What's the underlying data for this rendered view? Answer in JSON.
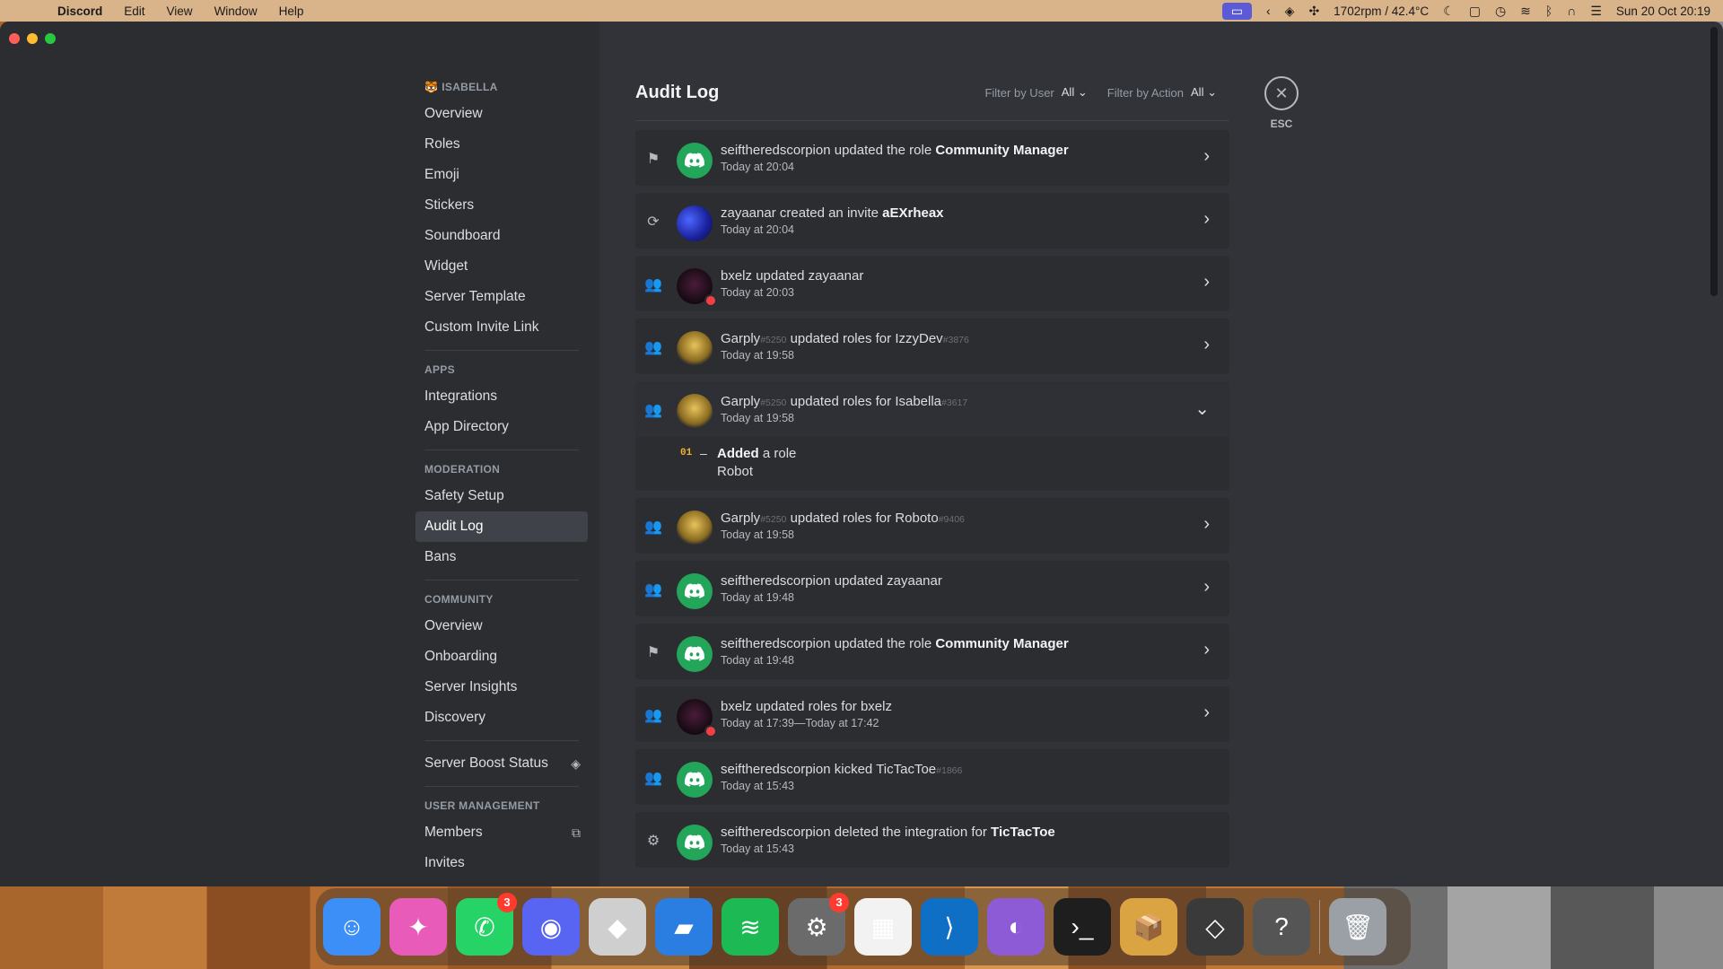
{
  "menubar": {
    "app_name": "Discord",
    "menus": [
      "Edit",
      "View",
      "Window",
      "Help"
    ],
    "fan_status": "1702rpm / 42.4°C",
    "datetime": "Sun 20 Oct  20:19"
  },
  "sidebar": {
    "server_name": "ISABELLA",
    "server_emoji": "🐯",
    "group1": [
      "Overview",
      "Roles",
      "Emoji",
      "Stickers",
      "Soundboard",
      "Widget",
      "Server Template",
      "Custom Invite Link"
    ],
    "apps_header": "APPS",
    "apps": [
      "Integrations",
      "App Directory"
    ],
    "moderation_header": "MODERATION",
    "moderation": [
      "Safety Setup",
      "Audit Log",
      "Bans"
    ],
    "community_header": "COMMUNITY",
    "community": [
      "Overview",
      "Onboarding",
      "Server Insights",
      "Discovery"
    ],
    "boost": "Server Boost Status",
    "user_mgmt_header": "USER MANAGEMENT",
    "user_mgmt": [
      "Members",
      "Invites"
    ]
  },
  "content": {
    "title": "Audit Log",
    "filter_user_label": "Filter by User",
    "filter_user_value": "All",
    "filter_action_label": "Filter by Action",
    "filter_action_value": "All"
  },
  "esc": {
    "label": "ESC",
    "icon": "close-icon"
  },
  "entries": [
    {
      "icon": "flag-icon",
      "avatar": "discord",
      "actor": "seiftheredscorpion",
      "actor_tag": "",
      "action": "updated the role",
      "target": "Community Manager",
      "target_tag": "",
      "target_bold": true,
      "time": "Today at 20:04"
    },
    {
      "icon": "invite-icon",
      "avatar": "blue",
      "actor": "zayaanar",
      "actor_tag": "",
      "action": "created an invite",
      "target": "aEXrheax",
      "target_tag": "",
      "target_bold": true,
      "time": "Today at 20:04"
    },
    {
      "icon": "member-icon",
      "avatar": "dark",
      "actor": "bxelz",
      "actor_tag": "",
      "action": "updated",
      "target": "zayaanar",
      "target_tag": "",
      "target_bold": false,
      "time": "Today at 20:03"
    },
    {
      "icon": "member-icon",
      "avatar": "robot",
      "actor": "Garply",
      "actor_tag": "#5250",
      "action": "updated roles for",
      "target": "IzzyDev",
      "target_tag": "#3876",
      "target_bold": false,
      "time": "Today at 19:58"
    },
    {
      "icon": "member-icon",
      "avatar": "robot",
      "actor": "Garply",
      "actor_tag": "#5250",
      "action": "updated roles for",
      "target": "Isabella",
      "target_tag": "#3617",
      "target_bold": false,
      "time": "Today at 19:58"
    },
    {
      "icon": "member-icon",
      "avatar": "robot",
      "actor": "Garply",
      "actor_tag": "#5250",
      "action": "updated roles for",
      "target": "Roboto",
      "target_tag": "#9406",
      "target_bold": false,
      "time": "Today at 19:58"
    },
    {
      "icon": "member-icon",
      "avatar": "discord",
      "actor": "seiftheredscorpion",
      "actor_tag": "",
      "action": "updated",
      "target": "zayaanar",
      "target_tag": "",
      "target_bold": false,
      "time": "Today at 19:48"
    },
    {
      "icon": "flag-icon",
      "avatar": "discord",
      "actor": "seiftheredscorpion",
      "actor_tag": "",
      "action": "updated the role",
      "target": "Community Manager",
      "target_tag": "",
      "target_bold": true,
      "time": "Today at 19:48"
    },
    {
      "icon": "member-icon",
      "avatar": "dark",
      "actor": "bxelz",
      "actor_tag": "",
      "action": "updated roles for",
      "target": "bxelz",
      "target_tag": "",
      "target_bold": false,
      "time": "Today at 17:39—Today at 17:42"
    },
    {
      "icon": "member-kick-icon",
      "avatar": "discord",
      "actor": "seiftheredscorpion",
      "actor_tag": "",
      "action": "kicked",
      "target": "TicTacToe",
      "target_tag": "#1866",
      "target_bold": false,
      "time": "Today at 15:43"
    },
    {
      "icon": "integration-icon",
      "avatar": "discord",
      "actor": "seiftheredscorpion",
      "actor_tag": "",
      "action": "deleted the integration for",
      "target": "TicTacToe",
      "target_tag": "",
      "target_bold": true,
      "time": "Today at 15:43"
    }
  ],
  "expanded_detail": {
    "index": "01",
    "dash": "–",
    "action_bold": "Added",
    "action_rest": "a role",
    "role": "Robot"
  },
  "dock": [
    {
      "name": "finder",
      "badge": ""
    },
    {
      "name": "pixelmator",
      "badge": ""
    },
    {
      "name": "whatsapp",
      "badge": "3"
    },
    {
      "name": "discord",
      "badge": ""
    },
    {
      "name": "roblox",
      "badge": ""
    },
    {
      "name": "roblox-studio",
      "badge": ""
    },
    {
      "name": "spotify",
      "badge": ""
    },
    {
      "name": "system-settings",
      "badge": "3"
    },
    {
      "name": "launchpad",
      "badge": ""
    },
    {
      "name": "vscode",
      "badge": ""
    },
    {
      "name": "github-desktop",
      "badge": ""
    },
    {
      "name": "terminal",
      "badge": ""
    },
    {
      "name": "installer",
      "badge": ""
    },
    {
      "name": "unity",
      "badge": ""
    },
    {
      "name": "unknown-app",
      "badge": ""
    },
    {
      "name": "trash",
      "badge": ""
    }
  ]
}
